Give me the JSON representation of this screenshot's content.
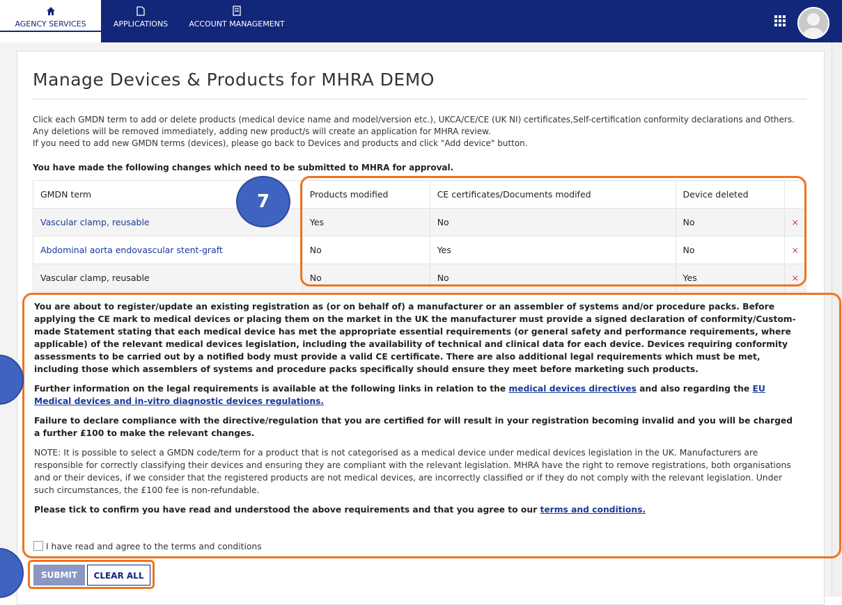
{
  "nav": {
    "items": [
      {
        "label": "AGENCY SERVICES",
        "icon": "home-icon",
        "active": true
      },
      {
        "label": "APPLICATIONS",
        "icon": "document-icon",
        "active": false
      },
      {
        "label": "ACCOUNT MANAGEMENT",
        "icon": "building-icon",
        "active": false
      }
    ]
  },
  "page": {
    "title": "Manage Devices & Products for MHRA DEMO",
    "intro1": "Click each GMDN term to add or delete products (medical device name and model/version etc.), UKCA/CE/CE (UK NI) certificates,Self-certification conformity declarations and Others. Any deletions will be removed immediately, adding new product/s will create an application for MHRA review.",
    "intro2": "If you need to add new GMDN terms (devices), please go back to Devices and products and click \"Add device\" button.",
    "changes_title": "You have made the following changes which need to be submitted to MHRA for approval."
  },
  "table": {
    "headers": [
      "GMDN term",
      "Products modified",
      "CE certificates/Documents modifed",
      "Device deleted"
    ],
    "rows": [
      [
        "Vascular clamp, reusable",
        "Yes",
        "No",
        "No"
      ],
      [
        "Abdominal aorta endovascular stent-graft",
        "No",
        "Yes",
        "No"
      ],
      [
        "Vascular clamp, reusable",
        "No",
        "No",
        "Yes"
      ]
    ],
    "delete_symbol": "×"
  },
  "legal": {
    "p1": "You are about to register/update an existing registration as (or on behalf of) a manufacturer or an assembler of systems and/or procedure packs. Before applying the CE mark to medical devices or placing them on the market in the UK the manufacturer must provide a signed declaration of conformity/Custom-made Statement stating that each medical device has met the appropriate essential requirements (or general safety and performance requirements, where applicable) of the relevant medical devices legislation, including the availability of technical and clinical data for each device. Devices requiring conformity assessments to be carried out by a notified body must provide a valid CE certificate. There are also additional legal requirements which must be met, including those which assemblers of systems and procedure packs specifically should ensure they meet before marketing such products.",
    "p2_pre": "Further information on the legal requirements is available at the following links in relation to the ",
    "p2_link1": "medical devices directives",
    "p2_mid": " and also regarding the ",
    "p2_link2": "EU Medical devices and in-vitro diagnostic devices regulations.",
    "p3": "Failure to declare compliance with the directive/regulation that you are certified for will result in your registration becoming invalid and you will be charged a further £100 to make the relevant changes.",
    "note": "NOTE: It is possible to select a GMDN code/term for a product that is not categorised as a medical device under medical devices legislation in the UK. Manufacturers are responsible for correctly classifying their devices and ensuring they are compliant with the relevant legislation. MHRA have the right to remove registrations, both organisations and or their devices, if we consider that the registered products are not medical devices, are incorrectly classified or if they do not comply with the relevant legislation. Under such circumstances, the £100 fee is non-refundable.",
    "confirm_pre": "Please tick to confirm you have read and understood the above requirements and that you agree to our ",
    "confirm_link": "terms and conditions.",
    "checkbox_label": "I have read and agree to the terms and conditions"
  },
  "buttons": {
    "submit": "SUBMIT",
    "clear": "CLEAR ALL"
  },
  "annotation": {
    "number": "7",
    "color": "#f0731e"
  }
}
